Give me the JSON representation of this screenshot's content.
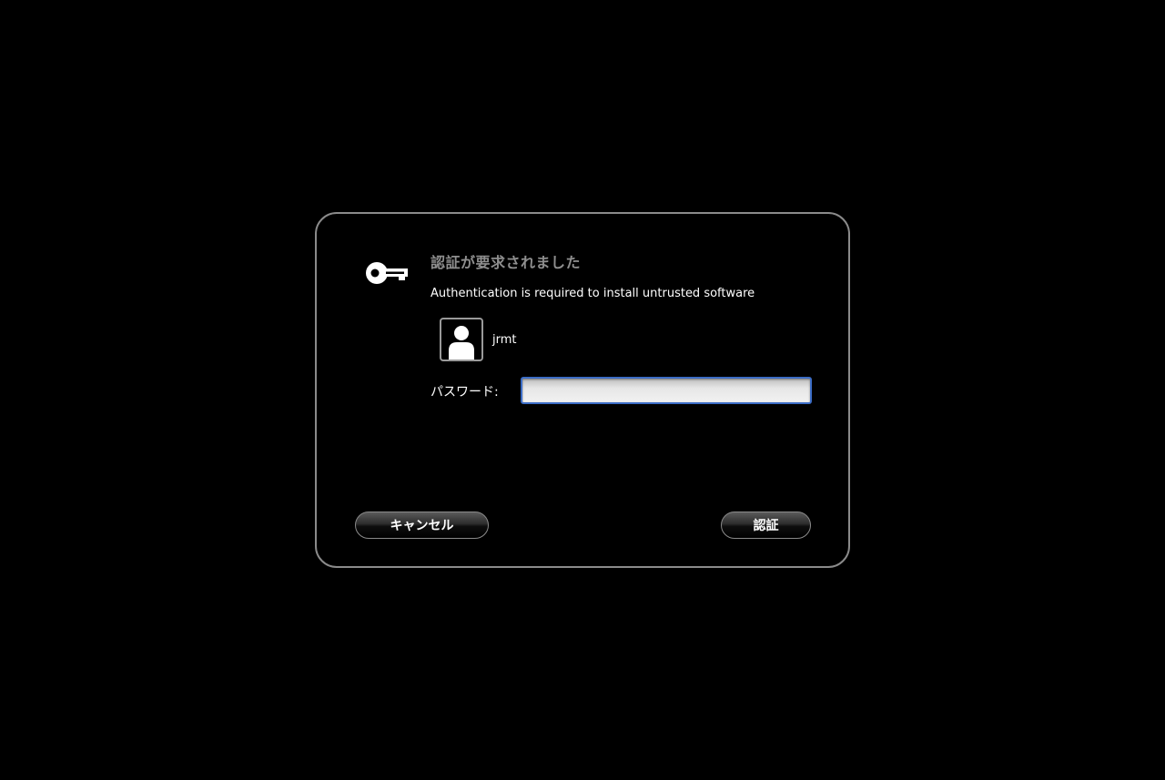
{
  "dialog": {
    "title": "認証が要求されました",
    "message": "Authentication is required to install untrusted software",
    "user": {
      "name": "jrmt",
      "avatar_icon": "user-avatar-icon"
    },
    "password": {
      "label": "パスワード:",
      "value": ""
    },
    "buttons": {
      "cancel_label": "キャンセル",
      "authenticate_label": "認証"
    },
    "icon": "key-icon",
    "colors": {
      "background": "#000000",
      "border": "#8a8a8a",
      "title": "#8e8e8e",
      "focus_ring": "#3b6cc5"
    }
  }
}
